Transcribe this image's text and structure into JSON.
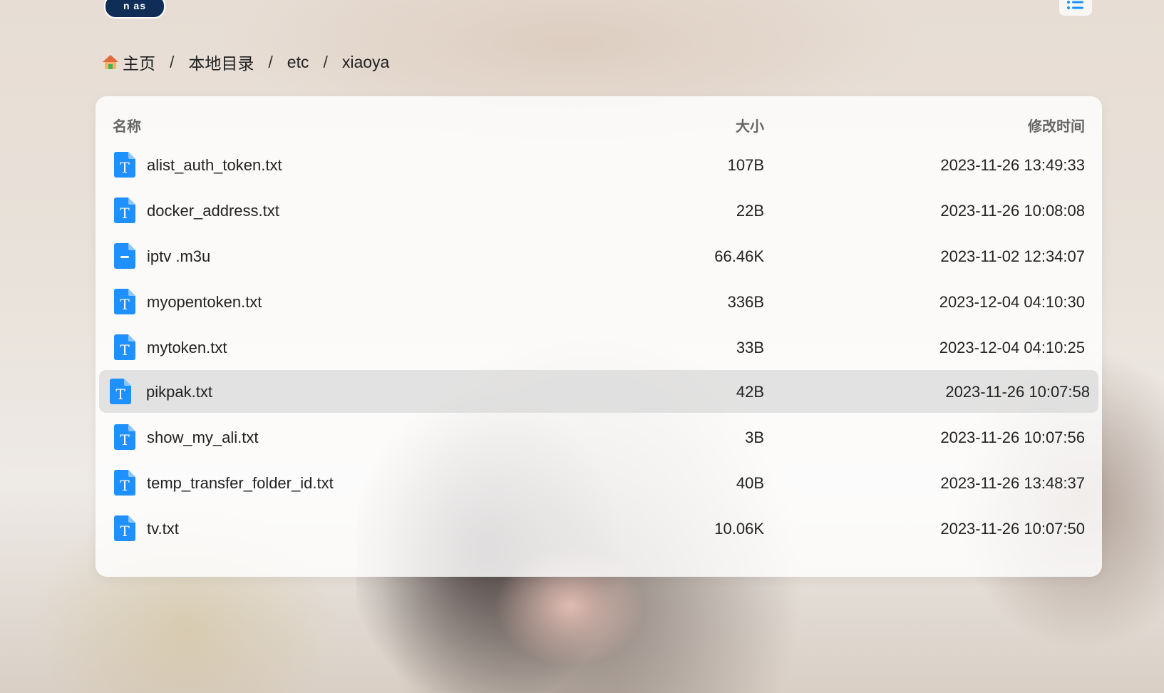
{
  "logo": {
    "text": "n as"
  },
  "breadcrumb": [
    {
      "label": "主页",
      "icon": "home-icon"
    },
    {
      "label": "本地目录"
    },
    {
      "label": "etc"
    },
    {
      "label": "xiaoya"
    }
  ],
  "breadcrumb_separator": "/",
  "table": {
    "headers": {
      "name": "名称",
      "size": "大小",
      "modified": "修改时间"
    },
    "rows": [
      {
        "name": "alist_auth_token.txt",
        "size": "107B",
        "modified": "2023-11-26 13:49:33",
        "icon": "text-file-icon"
      },
      {
        "name": "docker_address.txt",
        "size": "22B",
        "modified": "2023-11-26 10:08:08",
        "icon": "text-file-icon"
      },
      {
        "name": "iptv .m3u",
        "size": "66.46K",
        "modified": "2023-11-02 12:34:07",
        "icon": "generic-file-icon"
      },
      {
        "name": "myopentoken.txt",
        "size": "336B",
        "modified": "2023-12-04 04:10:30",
        "icon": "text-file-icon"
      },
      {
        "name": "mytoken.txt",
        "size": "33B",
        "modified": "2023-12-04 04:10:25",
        "icon": "text-file-icon"
      },
      {
        "name": "pikpak.txt",
        "size": "42B",
        "modified": "2023-11-26 10:07:58",
        "icon": "text-file-icon",
        "selected": true
      },
      {
        "name": "show_my_ali.txt",
        "size": "3B",
        "modified": "2023-11-26 10:07:56",
        "icon": "text-file-icon"
      },
      {
        "name": "temp_transfer_folder_id.txt",
        "size": "40B",
        "modified": "2023-11-26 13:48:37",
        "icon": "text-file-icon"
      },
      {
        "name": "tv.txt",
        "size": "10.06K",
        "modified": "2023-11-26 10:07:50",
        "icon": "text-file-icon"
      }
    ]
  },
  "colors": {
    "accent": "#1e90ff",
    "selected_row": "#d9d9d9",
    "logo_bg": "#0f2d57"
  }
}
